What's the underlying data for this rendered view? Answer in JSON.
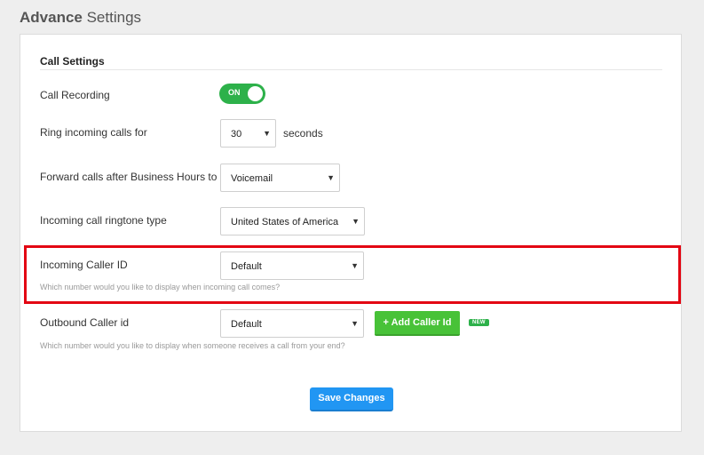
{
  "page": {
    "title_bold": "Advance",
    "title_rest": " Settings"
  },
  "call_settings": {
    "section_title": "Call Settings",
    "call_recording": {
      "label": "Call Recording",
      "toggle_text": "ON"
    },
    "ring_incoming": {
      "label": "Ring incoming calls for",
      "value": "30",
      "unit": "seconds"
    },
    "forward_calls": {
      "label": "Forward calls after Business Hours to",
      "value": "Voicemail"
    },
    "ringtone_type": {
      "label": "Incoming call ringtone type",
      "value": "United States of America"
    },
    "incoming_caller_id": {
      "label": "Incoming Caller ID",
      "value": "Default",
      "hint": "Which number would you like to display when incoming call comes?"
    },
    "outbound_caller_id": {
      "label": "Outbound Caller id",
      "value": "Default",
      "add_button": "+ Add Caller Id",
      "badge": "NEW",
      "hint": "Which number would you like to display when someone receives a call from your end?"
    }
  },
  "actions": {
    "save_label": "Save Changes"
  },
  "colors": {
    "toggle_on": "#2db14a",
    "add_button": "#48c238",
    "save_button": "#2196f3",
    "highlight_border": "#e30613"
  },
  "icons": {
    "caret": "caret-down-icon"
  }
}
